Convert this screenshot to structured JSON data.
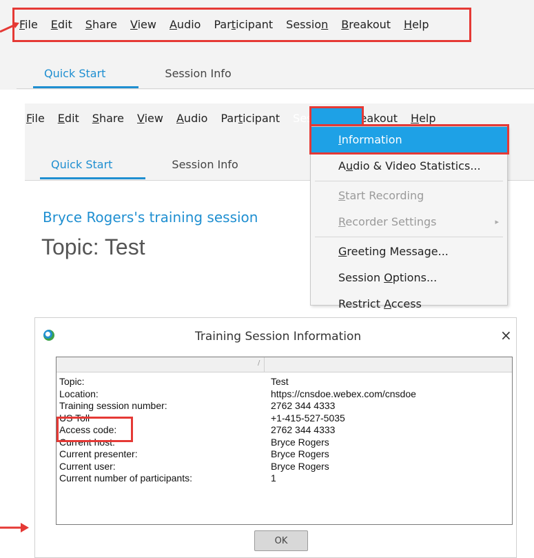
{
  "menu_top": {
    "items": [
      {
        "label": "File",
        "ul": 0
      },
      {
        "label": "Edit",
        "ul": 0
      },
      {
        "label": "Share",
        "ul": 0
      },
      {
        "label": "View",
        "ul": 0
      },
      {
        "label": "Audio",
        "ul": 0
      },
      {
        "label": "Participant",
        "ul": 3
      },
      {
        "label": "Session",
        "ul": 6
      },
      {
        "label": "Breakout",
        "ul": 0
      },
      {
        "label": "Help",
        "ul": 0
      }
    ]
  },
  "tabs_top": {
    "quick_start": "Quick Start",
    "session_info": "Session Info"
  },
  "menu_second": {
    "items": [
      {
        "label": "File",
        "ul": 0
      },
      {
        "label": "Edit",
        "ul": 0
      },
      {
        "label": "Share",
        "ul": 0
      },
      {
        "label": "View",
        "ul": 0
      },
      {
        "label": "Audio",
        "ul": 0
      },
      {
        "label": "Participant",
        "ul": 3
      },
      {
        "label": "Session",
        "ul": 6
      },
      {
        "label": "Breakout",
        "ul": 0
      },
      {
        "label": "Help",
        "ul": 0
      }
    ]
  },
  "tabs_second": {
    "quick_start": "Quick Start",
    "session_info": "Session Info"
  },
  "session_owner": "Bryce Rogers's training session",
  "topic_line": "Topic: Test",
  "session_menu": {
    "items": [
      {
        "label": "Information",
        "state": "selected",
        "ul": 0
      },
      {
        "label": "Audio & Video Statistics...",
        "state": "normal",
        "ul": 1
      },
      {
        "label": "Start Recording",
        "state": "disabled",
        "ul": 0
      },
      {
        "label": "Recorder Settings",
        "state": "disabled",
        "ul": 0,
        "submenu": true
      },
      {
        "label": "Greeting Message...",
        "state": "normal",
        "ul": 0
      },
      {
        "label": "Session Options...",
        "state": "normal",
        "ul": 8
      },
      {
        "label": "Restrict Access",
        "state": "normal",
        "ul": 9
      }
    ]
  },
  "dialog": {
    "title": "Training Session Information",
    "close": "×",
    "rows": [
      {
        "label": "Topic:",
        "value": "Test"
      },
      {
        "label": "Location:",
        "value": "https://cnsdoe.webex.com/cnsdoe"
      },
      {
        "label": "Training session number:",
        "value": "2762 344 4333"
      },
      {
        "label": "US Toll",
        "value": "+1-415-527-5035"
      },
      {
        "label": "Access code:",
        "value": "2762 344 4333"
      },
      {
        "label": "Current host:",
        "value": "Bryce Rogers"
      },
      {
        "label": "Current presenter:",
        "value": "Bryce Rogers"
      },
      {
        "label": "Current user:",
        "value": "Bryce Rogers"
      },
      {
        "label": "Current number of participants:",
        "value": "1"
      }
    ],
    "ok_label": "OK"
  },
  "accent_colors": {
    "blue": "#1f8fd1",
    "highlight": "#1ea1e6",
    "callout_red": "#e53935"
  }
}
